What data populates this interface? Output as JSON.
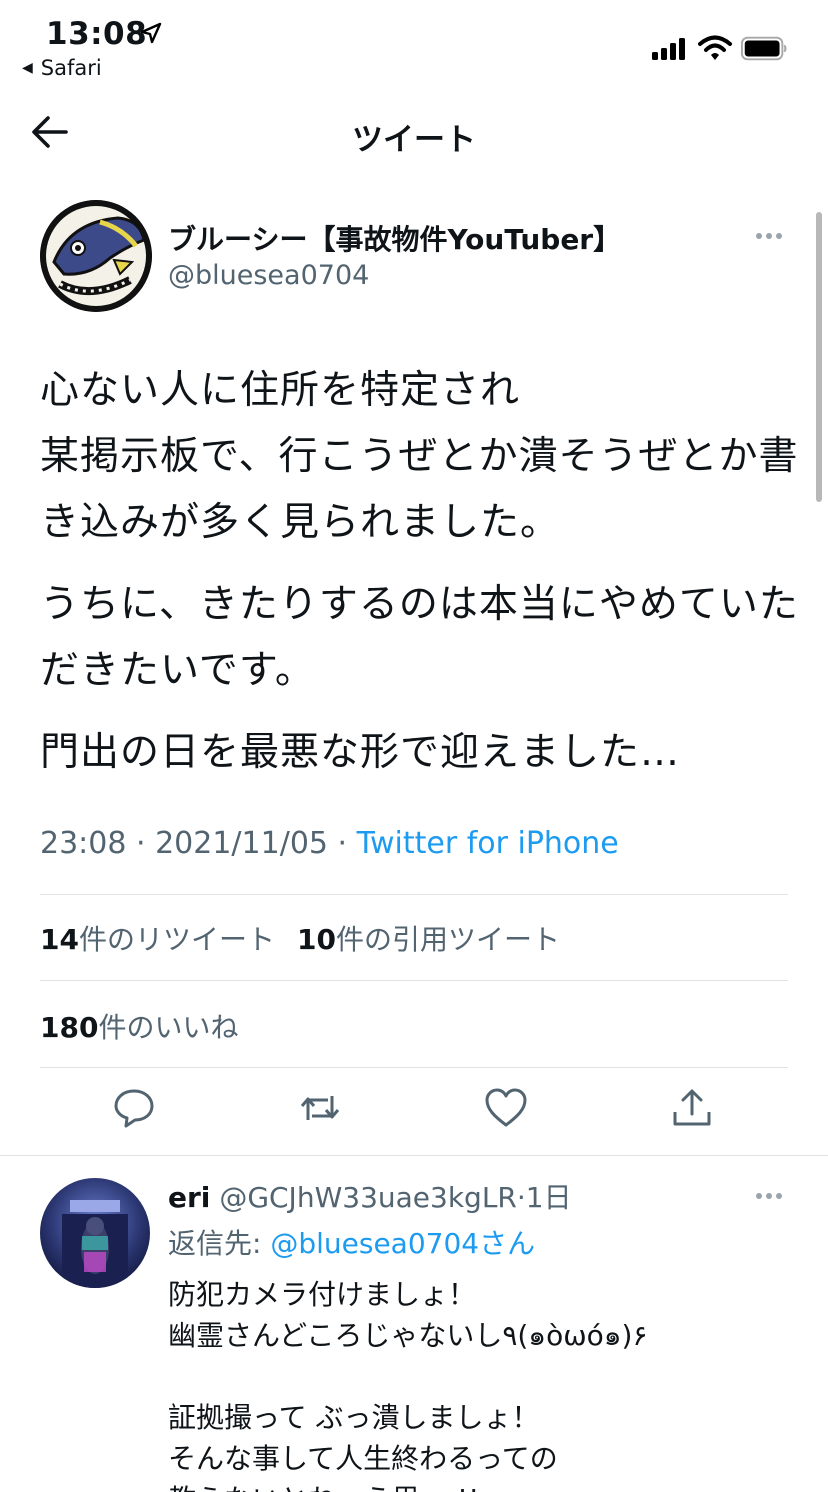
{
  "status_bar": {
    "time": "13:08",
    "back_app": "Safari"
  },
  "nav": {
    "title": "ツイート"
  },
  "tweet": {
    "author_name": "ブルーシー【事故物件YouTuber】",
    "author_handle": "@bluesea0704",
    "paragraphs": [
      "心ない人に住所を特定され\n某掲示板で、行こうぜとか潰そうぜとか書き込みが多く見られました。",
      "うちに、きたりするのは本当にやめていただきたいです。",
      "門出の日を最悪な形で迎えました…"
    ],
    "time": "23:08",
    "date": "2021/11/05",
    "separator": " · ",
    "source": "Twitter for iPhone",
    "retweets_count": "14",
    "retweets_label": "件のリツイート",
    "quotes_count": "10",
    "quotes_label": "件の引用ツイート",
    "likes_count": "180",
    "likes_label": "件のいいね"
  },
  "reply": {
    "name": "eri",
    "handle": "@GCJhW33uae3kgLR",
    "separator": "·",
    "age": "1日",
    "reply_prefix": "返信先: ",
    "reply_mention": "@bluesea0704さん",
    "text": "防犯カメラ付けましょ！\n幽霊さんどころじゃないし٩(๑òωó๑)۶\n\n証拠撮って ぶっ潰しましょ！\nそんな事して人生終わるっての\n教えないとね〜う思… !!"
  },
  "colors": {
    "link": "#1d9bf0",
    "secondary_text": "#536471",
    "divider": "#dfe3e6"
  },
  "icons": [
    "location-arrow-icon",
    "signal-icon",
    "wifi-icon",
    "battery-icon",
    "back-arrow-icon",
    "more-icon",
    "reply-icon",
    "retweet-icon",
    "like-icon",
    "share-icon"
  ]
}
